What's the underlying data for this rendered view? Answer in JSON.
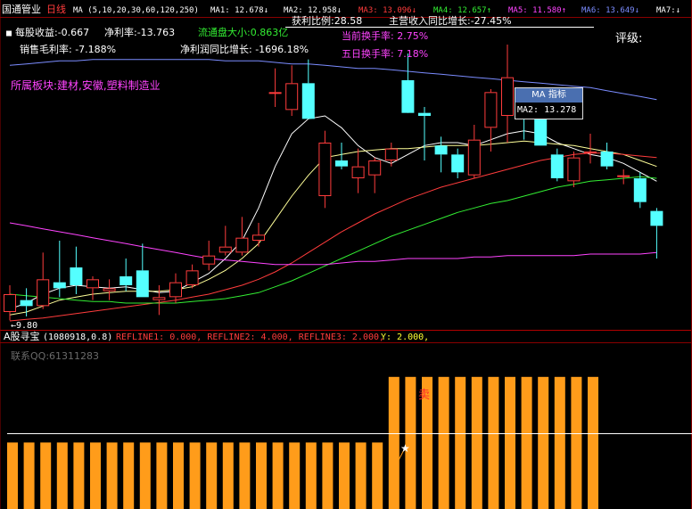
{
  "header": {
    "stock_name": "国通管业",
    "period": "日线",
    "ma_params": "MA (5,10,20,30,60,120,250)",
    "ma_values": [
      {
        "label": "MA1: 12.678",
        "arrow": "↓",
        "color": "#ffffff"
      },
      {
        "label": "MA2: 12.958",
        "arrow": "↓",
        "color": "#ffffff"
      },
      {
        "label": "MA3: 13.096",
        "arrow": "↓",
        "color": "#ff3c3c"
      },
      {
        "label": "MA4: 12.657",
        "arrow": "↑",
        "color": "#33ee33"
      },
      {
        "label": "MA5: 11.580",
        "arrow": "↑",
        "color": "#ff44ff"
      },
      {
        "label": "MA6: 13.649",
        "arrow": "↓",
        "color": "#7b8cff"
      },
      {
        "label": "MA7:",
        "arrow": "↓",
        "color": "#ffffff"
      }
    ]
  },
  "info": {
    "eps": "每股收益:-0.667",
    "net_margin": "净利率:-13.763",
    "float_cap": "流通盘大小:0.863亿",
    "profit_ratio": "获利比例:28.58",
    "revenue_growth": "主营收入同比增长:-27.45%",
    "turnover_today": "当前换手率: 2.75%",
    "turnover_5d": "五日换手率: 7.18%",
    "gross_margin": "销售毛利率: -7.188%",
    "net_profit_growth": "净利润同比增长: -1696.18%",
    "rating": "评级:",
    "sector": "所属板块:建材,安徽,塑料制造业",
    "low_label": "←9.80"
  },
  "tooltip": {
    "title": "MA 指标",
    "row": "MA2:  13.278"
  },
  "sub": {
    "title": "A股寻宝",
    "params": "(1080918,0.8)",
    "reflines": "REFLINE1: 0.000, REFLINE2: 4.000, REFLINE3: 2.000,",
    "y_value": "Y: 2.000,",
    "contact": "联系QQ:61311283",
    "sell_label": "卖"
  },
  "colors": {
    "up": "#ff3c3c",
    "down": "#54ffff",
    "ma1": "#ffffff",
    "ma2": "#ffff99",
    "ma3": "#ff3c3c",
    "ma4": "#33ee33",
    "ma5": "#ff44ff",
    "ma6": "#7b8cff",
    "bar": "#ff9c1a"
  },
  "chart_data": {
    "type": "candlestick",
    "candles": [
      {
        "o": 10.1,
        "h": 11.0,
        "l": 9.82,
        "c": 10.7
      },
      {
        "o": 10.5,
        "h": 10.9,
        "l": 9.95,
        "c": 10.3
      },
      {
        "o": 10.3,
        "h": 12.1,
        "l": 10.2,
        "c": 11.2
      },
      {
        "o": 11.1,
        "h": 12.5,
        "l": 10.6,
        "c": 10.9
      },
      {
        "o": 11.6,
        "h": 12.3,
        "l": 10.7,
        "c": 11.0
      },
      {
        "o": 10.9,
        "h": 11.3,
        "l": 10.5,
        "c": 11.2
      },
      {
        "o": 10.8,
        "h": 11.2,
        "l": 10.5,
        "c": 10.9
      },
      {
        "o": 11.3,
        "h": 11.9,
        "l": 10.8,
        "c": 11.0
      },
      {
        "o": 11.5,
        "h": 12.4,
        "l": 10.6,
        "c": 10.6
      },
      {
        "o": 10.5,
        "h": 11.0,
        "l": 10.0,
        "c": 10.6
      },
      {
        "o": 10.6,
        "h": 11.4,
        "l": 10.4,
        "c": 11.1
      },
      {
        "o": 11.0,
        "h": 11.7,
        "l": 10.9,
        "c": 11.5
      },
      {
        "o": 11.7,
        "h": 12.5,
        "l": 11.5,
        "c": 12.0
      },
      {
        "o": 12.1,
        "h": 13.0,
        "l": 12.0,
        "c": 12.3
      },
      {
        "o": 12.1,
        "h": 13.3,
        "l": 12.0,
        "c": 12.6
      },
      {
        "o": 12.5,
        "h": 13.1,
        "l": 12.3,
        "c": 12.7
      },
      {
        "o": 17.5,
        "h": 18.3,
        "l": 17.0,
        "c": 17.5
      },
      {
        "o": 16.9,
        "h": 18.4,
        "l": 16.7,
        "c": 17.8
      },
      {
        "o": 17.8,
        "h": 18.6,
        "l": 16.7,
        "c": 16.6
      },
      {
        "o": 14.0,
        "h": 16.2,
        "l": 13.6,
        "c": 15.8
      },
      {
        "o": 15.2,
        "h": 15.8,
        "l": 14.9,
        "c": 15.0
      },
      {
        "o": 14.6,
        "h": 15.6,
        "l": 14.1,
        "c": 15.0
      },
      {
        "o": 14.7,
        "h": 15.3,
        "l": 14.1,
        "c": 15.2
      },
      {
        "o": 15.2,
        "h": 15.8,
        "l": 15.0,
        "c": 15.6
      },
      {
        "o": 17.9,
        "h": 18.8,
        "l": 17.0,
        "c": 16.8
      },
      {
        "o": 16.8,
        "h": 17.0,
        "l": 15.2,
        "c": 16.7
      },
      {
        "o": 15.7,
        "h": 16.0,
        "l": 14.8,
        "c": 15.4
      },
      {
        "o": 15.4,
        "h": 15.6,
        "l": 14.6,
        "c": 14.8
      },
      {
        "o": 14.7,
        "h": 16.4,
        "l": 14.6,
        "c": 15.9
      },
      {
        "o": 16.3,
        "h": 17.6,
        "l": 15.5,
        "c": 17.5
      },
      {
        "o": 16.7,
        "h": 19.1,
        "l": 15.8,
        "c": 18.0
      },
      {
        "o": 17.3,
        "h": 17.6,
        "l": 15.9,
        "c": 16.9
      },
      {
        "o": 16.7,
        "h": 16.9,
        "l": 15.7,
        "c": 15.7
      },
      {
        "o": 15.4,
        "h": 15.6,
        "l": 14.5,
        "c": 14.6
      },
      {
        "o": 14.5,
        "h": 15.5,
        "l": 14.3,
        "c": 15.3
      },
      {
        "o": 15.5,
        "h": 16.1,
        "l": 15.1,
        "c": 15.5
      },
      {
        "o": 15.5,
        "h": 15.8,
        "l": 14.9,
        "c": 15.0
      },
      {
        "o": 14.7,
        "h": 14.9,
        "l": 14.4,
        "c": 14.7
      },
      {
        "o": 14.6,
        "h": 14.8,
        "l": 13.6,
        "c": 13.8
      },
      {
        "o": 13.5,
        "h": 13.6,
        "l": 11.9,
        "c": 13.0
      }
    ],
    "ma_lines": [
      {
        "key": "ma1",
        "values": [
          10.2,
          10.4,
          10.7,
          10.9,
          11.0,
          10.95,
          10.9,
          10.95,
          10.85,
          10.75,
          10.8,
          11.1,
          11.4,
          11.9,
          12.5,
          13.6,
          15.0,
          16.1,
          16.6,
          16.7,
          16.3,
          15.7,
          15.3,
          15.1,
          15.4,
          15.7,
          15.8,
          15.8,
          15.7,
          15.9,
          16.1,
          16.2,
          16.1,
          15.8,
          15.6,
          15.4,
          15.3,
          15.1,
          14.8,
          14.5
        ]
      },
      {
        "key": "ma2",
        "values": [
          10.0,
          10.1,
          10.3,
          10.5,
          10.6,
          10.7,
          10.75,
          10.8,
          10.8,
          10.8,
          10.85,
          10.95,
          11.2,
          11.5,
          11.9,
          12.4,
          13.2,
          14.0,
          14.7,
          15.3,
          15.4,
          15.5,
          15.55,
          15.6,
          15.6,
          15.65,
          15.7,
          15.7,
          15.7,
          15.75,
          15.8,
          15.85,
          15.8,
          15.75,
          15.7,
          15.6,
          15.5,
          15.4,
          15.2,
          15.0
        ]
      },
      {
        "key": "ma3",
        "values": [
          9.8,
          9.85,
          9.9,
          9.97,
          10.05,
          10.12,
          10.2,
          10.27,
          10.35,
          10.42,
          10.5,
          10.6,
          10.7,
          10.85,
          11.0,
          11.2,
          11.45,
          11.75,
          12.1,
          12.45,
          12.8,
          13.1,
          13.4,
          13.65,
          13.9,
          14.1,
          14.3,
          14.45,
          14.6,
          14.75,
          14.9,
          15.05,
          15.2,
          15.3,
          15.4,
          15.45,
          15.45,
          15.4,
          15.35,
          15.3
        ]
      },
      {
        "key": "ma4",
        "values": [
          10.7,
          10.65,
          10.6,
          10.55,
          10.5,
          10.45,
          10.45,
          10.4,
          10.4,
          10.4,
          10.4,
          10.45,
          10.5,
          10.55,
          10.65,
          10.75,
          10.95,
          11.15,
          11.4,
          11.65,
          11.9,
          12.15,
          12.4,
          12.65,
          12.85,
          13.05,
          13.25,
          13.45,
          13.6,
          13.75,
          13.85,
          14.0,
          14.15,
          14.3,
          14.4,
          14.5,
          14.55,
          14.6,
          14.65,
          14.6
        ]
      },
      {
        "key": "ma5",
        "values": [
          13.1,
          13.0,
          12.9,
          12.8,
          12.7,
          12.6,
          12.5,
          12.4,
          12.3,
          12.2,
          12.1,
          12.0,
          11.9,
          11.85,
          11.8,
          11.75,
          11.7,
          11.7,
          11.7,
          11.7,
          11.75,
          11.8,
          11.8,
          11.85,
          11.9,
          11.9,
          11.9,
          11.9,
          11.95,
          11.95,
          12.0,
          12.0,
          12.0,
          12.0,
          12.0,
          12.05,
          12.05,
          12.05,
          12.05,
          12.1
        ]
      },
      {
        "key": "ma6",
        "values": [
          18.4,
          18.45,
          18.5,
          18.55,
          18.55,
          18.6,
          18.6,
          18.6,
          18.6,
          18.6,
          18.6,
          18.6,
          18.6,
          18.55,
          18.55,
          18.55,
          18.5,
          18.45,
          18.45,
          18.4,
          18.35,
          18.3,
          18.3,
          18.25,
          18.2,
          18.15,
          18.1,
          18.05,
          18.0,
          17.95,
          17.9,
          17.85,
          17.8,
          17.75,
          17.7,
          17.65,
          17.55,
          17.45,
          17.35,
          17.25
        ]
      }
    ],
    "price_range": [
      9.5,
      20.0
    ],
    "indicator": {
      "type": "bar",
      "values": [
        2,
        2,
        2,
        2,
        2,
        2,
        2,
        2,
        2,
        2,
        2,
        2,
        2,
        2,
        2,
        2,
        2,
        2,
        2,
        2,
        2,
        2,
        2,
        4,
        4,
        4,
        4,
        4,
        4,
        4,
        4,
        4,
        4,
        4,
        4,
        4
      ],
      "refline": 4,
      "ylim": [
        0,
        5
      ]
    }
  }
}
